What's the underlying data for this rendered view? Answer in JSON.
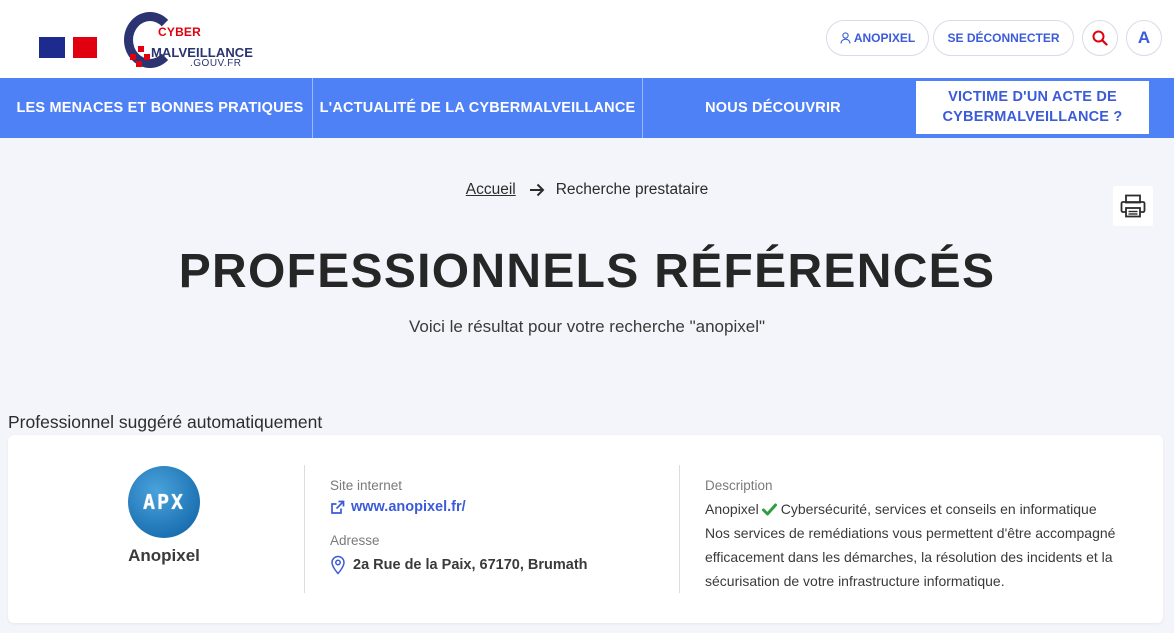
{
  "header": {
    "logo": {
      "line1": "CYBER",
      "line2": "MALVEILLANCE",
      "line3": ".GOUV.FR"
    },
    "user_button": "ANOPIXEL",
    "logout_button": "SE DÉCONNECTER",
    "contrast_button": "A",
    "icons": {
      "user": "user-icon",
      "search": "search-icon"
    }
  },
  "nav": {
    "items": [
      {
        "label": "LES MENACES ET BONNES PRATIQUES"
      },
      {
        "label": "L'ACTUALITÉ DE LA CYBERMALVEILLANCE"
      },
      {
        "label": "NOUS DÉCOUVRIR"
      }
    ],
    "cta_line1": "VICTIME D'UN ACTE DE",
    "cta_line2": "CYBERMALVEILLANCE ?"
  },
  "breadcrumb": {
    "home": "Accueil",
    "current": "Recherche prestataire"
  },
  "page": {
    "title": "PROFESSIONNELS RÉFÉRENCÉS",
    "subtitle": "Voici le résultat pour votre recherche \"anopixel\"",
    "section_label": "Professionnel suggéré automatiquement"
  },
  "result": {
    "avatar_text": "APX",
    "name": "Anopixel",
    "site_label": "Site internet",
    "site_url": "www.anopixel.fr/",
    "address_label": "Adresse",
    "address": "2a Rue de la Paix, 67170, Brumath",
    "description_label": "Description",
    "description_name": "Anopixel",
    "description_tagline": "Cybersécurité, services et conseils en informatique",
    "description_body": "Nos services de remédiations vous permettent d'être accompagné efficacement dans les démarches, la résolution des incidents et la sécurisation de votre infrastructure informatique."
  },
  "colors": {
    "accent": "#4f81f6",
    "link": "#3b5bd9",
    "brand_navy": "#2b3370",
    "brand_red": "#e1000f",
    "background": "#f4f5fb",
    "check_green": "#2e9e3e"
  }
}
